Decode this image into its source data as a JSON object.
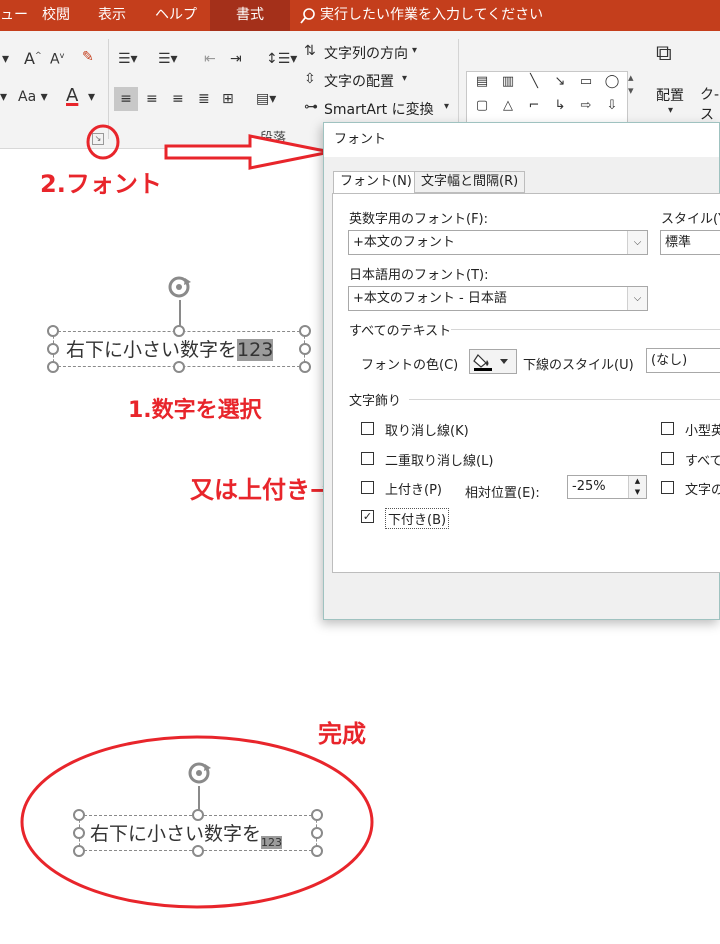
{
  "ribbon_tabs": [
    {
      "label": "ュー"
    },
    {
      "label": "校閲"
    },
    {
      "label": "表示"
    },
    {
      "label": "ヘルプ"
    },
    {
      "label": "書式"
    }
  ],
  "tellme": {
    "text": "実行したい作業を入力してください"
  },
  "ribbon": {
    "text_direction": "文字列の方向",
    "align_text": "文字の配置",
    "smartart": "SmartArt に変換",
    "paragraph_group": "段落",
    "arrange": "配置",
    "quick_styles": "ク-\nスタ"
  },
  "annotations": {
    "step2": "2.フォント",
    "step1": "1.数字を選択",
    "alt": "又は上付き",
    "done": "完成"
  },
  "textbox_top": {
    "text": "右下に小さい数字を",
    "selected": "123"
  },
  "textbox_bottom": {
    "text": "右下に小さい数字を",
    "sub": "123"
  },
  "dialog": {
    "title": "フォント",
    "tabs": [
      "フォント(N)",
      "文字幅と間隔(R)"
    ],
    "latin_font_label": "英数字用のフォント(F):",
    "latin_font_value": "+本文のフォント",
    "style_label": "スタイル(Y",
    "style_value": "標準",
    "asian_font_label": "日本語用のフォント(T):",
    "asian_font_value": "+本文のフォント - 日本語",
    "all_text": "すべてのテキスト",
    "font_color_label": "フォントの色(C)",
    "underline_label": "下線のスタイル(U)",
    "underline_value": "(なし)",
    "effects": "文字飾り",
    "strikethrough": "取り消し線(K)",
    "double_strike": "二重取り消し線(L)",
    "superscript": "上付き(P)",
    "offset_label": "相対位置(E):",
    "offset_value": "-25%",
    "subscript": "下付き(B)",
    "small_caps": "小型英",
    "all_caps": "すべて",
    "equalize": "文字の"
  },
  "colors": {
    "accent": "#c43e1c",
    "annotation": "#e8252b"
  }
}
